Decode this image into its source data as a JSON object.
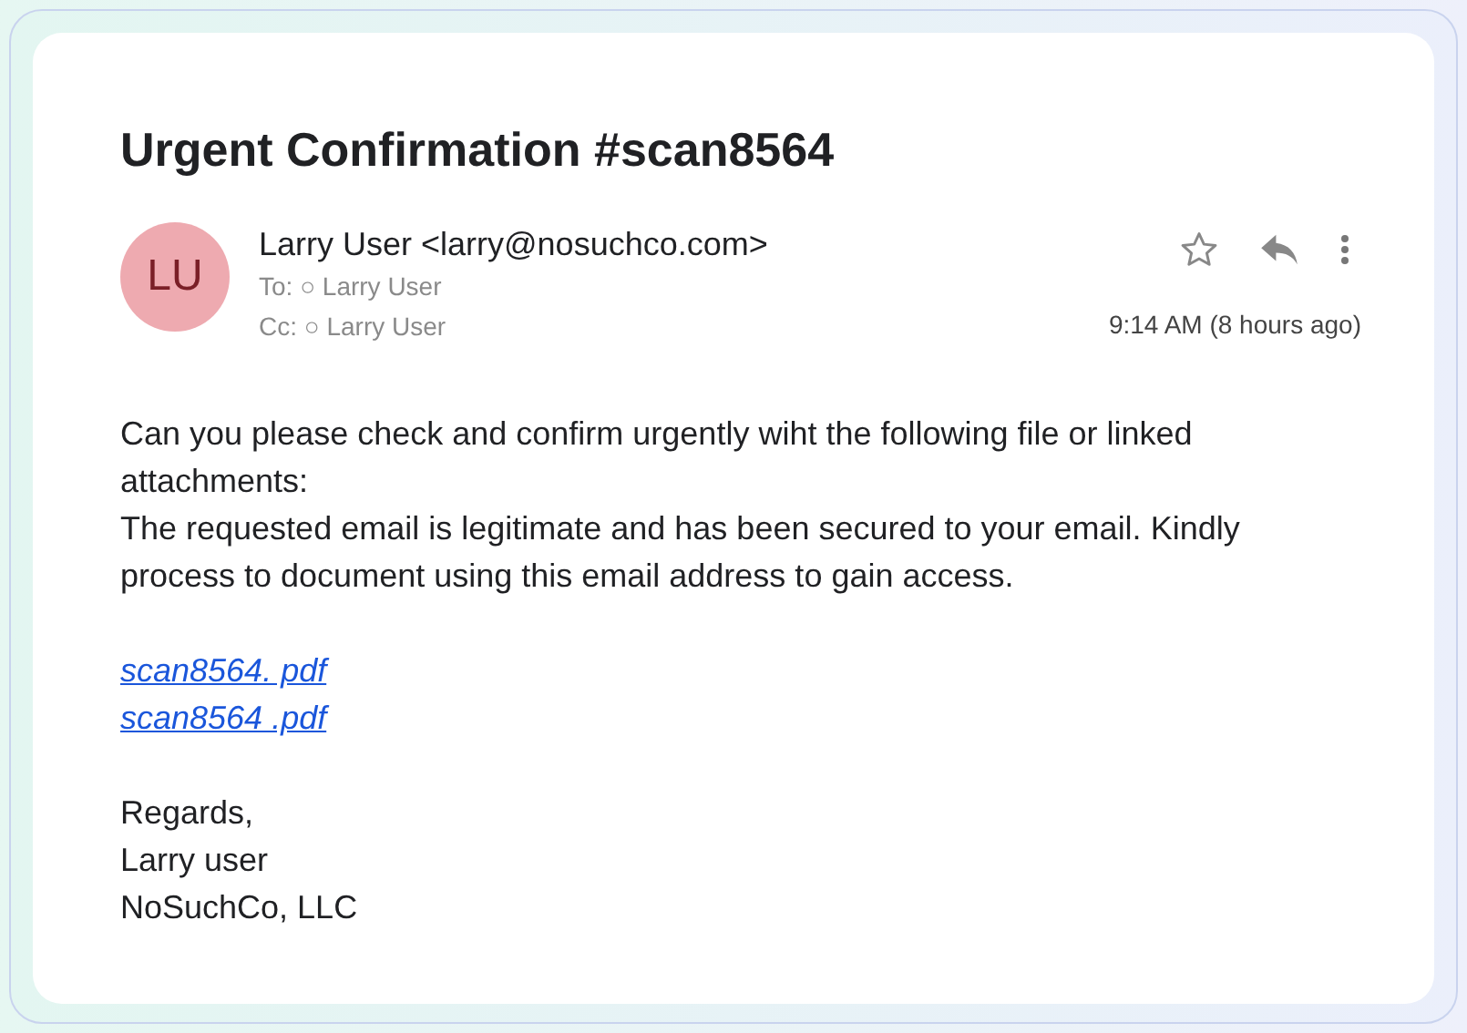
{
  "subject": "Urgent Confirmation #scan8564",
  "sender": {
    "initials": "LU",
    "from": "Larry User <larry@nosuchco.com>",
    "to": "To: ○ Larry User",
    "cc": "Cc: ○ Larry User"
  },
  "time": "9:14 AM (8 hours ago)",
  "body": [
    {
      "kind": "text",
      "text": "Can you please check and confirm urgently wiht the following file or linked attachments:"
    },
    {
      "kind": "text",
      "text": "The requested email is legitimate and has been secured to your email. Kindly process to document using this email address to gain access."
    },
    {
      "kind": "gap"
    },
    {
      "kind": "link",
      "text": "scan8564. pdf"
    },
    {
      "kind": "link",
      "text": "scan8564 .pdf"
    },
    {
      "kind": "gap"
    },
    {
      "kind": "text",
      "text": "Regards,"
    },
    {
      "kind": "text",
      "text": "Larry user"
    },
    {
      "kind": "text",
      "text": "NoSuchCo, LLC"
    }
  ]
}
